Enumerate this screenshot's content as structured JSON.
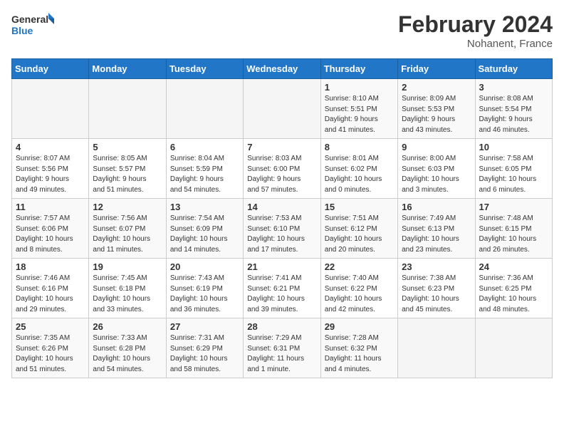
{
  "logo": {
    "line1": "General",
    "line2": "Blue"
  },
  "title": "February 2024",
  "location": "Nohanent, France",
  "days_of_week": [
    "Sunday",
    "Monday",
    "Tuesday",
    "Wednesday",
    "Thursday",
    "Friday",
    "Saturday"
  ],
  "weeks": [
    [
      {
        "day": "",
        "info": ""
      },
      {
        "day": "",
        "info": ""
      },
      {
        "day": "",
        "info": ""
      },
      {
        "day": "",
        "info": ""
      },
      {
        "day": "1",
        "info": "Sunrise: 8:10 AM\nSunset: 5:51 PM\nDaylight: 9 hours\nand 41 minutes."
      },
      {
        "day": "2",
        "info": "Sunrise: 8:09 AM\nSunset: 5:53 PM\nDaylight: 9 hours\nand 43 minutes."
      },
      {
        "day": "3",
        "info": "Sunrise: 8:08 AM\nSunset: 5:54 PM\nDaylight: 9 hours\nand 46 minutes."
      }
    ],
    [
      {
        "day": "4",
        "info": "Sunrise: 8:07 AM\nSunset: 5:56 PM\nDaylight: 9 hours\nand 49 minutes."
      },
      {
        "day": "5",
        "info": "Sunrise: 8:05 AM\nSunset: 5:57 PM\nDaylight: 9 hours\nand 51 minutes."
      },
      {
        "day": "6",
        "info": "Sunrise: 8:04 AM\nSunset: 5:59 PM\nDaylight: 9 hours\nand 54 minutes."
      },
      {
        "day": "7",
        "info": "Sunrise: 8:03 AM\nSunset: 6:00 PM\nDaylight: 9 hours\nand 57 minutes."
      },
      {
        "day": "8",
        "info": "Sunrise: 8:01 AM\nSunset: 6:02 PM\nDaylight: 10 hours\nand 0 minutes."
      },
      {
        "day": "9",
        "info": "Sunrise: 8:00 AM\nSunset: 6:03 PM\nDaylight: 10 hours\nand 3 minutes."
      },
      {
        "day": "10",
        "info": "Sunrise: 7:58 AM\nSunset: 6:05 PM\nDaylight: 10 hours\nand 6 minutes."
      }
    ],
    [
      {
        "day": "11",
        "info": "Sunrise: 7:57 AM\nSunset: 6:06 PM\nDaylight: 10 hours\nand 8 minutes."
      },
      {
        "day": "12",
        "info": "Sunrise: 7:56 AM\nSunset: 6:07 PM\nDaylight: 10 hours\nand 11 minutes."
      },
      {
        "day": "13",
        "info": "Sunrise: 7:54 AM\nSunset: 6:09 PM\nDaylight: 10 hours\nand 14 minutes."
      },
      {
        "day": "14",
        "info": "Sunrise: 7:53 AM\nSunset: 6:10 PM\nDaylight: 10 hours\nand 17 minutes."
      },
      {
        "day": "15",
        "info": "Sunrise: 7:51 AM\nSunset: 6:12 PM\nDaylight: 10 hours\nand 20 minutes."
      },
      {
        "day": "16",
        "info": "Sunrise: 7:49 AM\nSunset: 6:13 PM\nDaylight: 10 hours\nand 23 minutes."
      },
      {
        "day": "17",
        "info": "Sunrise: 7:48 AM\nSunset: 6:15 PM\nDaylight: 10 hours\nand 26 minutes."
      }
    ],
    [
      {
        "day": "18",
        "info": "Sunrise: 7:46 AM\nSunset: 6:16 PM\nDaylight: 10 hours\nand 29 minutes."
      },
      {
        "day": "19",
        "info": "Sunrise: 7:45 AM\nSunset: 6:18 PM\nDaylight: 10 hours\nand 33 minutes."
      },
      {
        "day": "20",
        "info": "Sunrise: 7:43 AM\nSunset: 6:19 PM\nDaylight: 10 hours\nand 36 minutes."
      },
      {
        "day": "21",
        "info": "Sunrise: 7:41 AM\nSunset: 6:21 PM\nDaylight: 10 hours\nand 39 minutes."
      },
      {
        "day": "22",
        "info": "Sunrise: 7:40 AM\nSunset: 6:22 PM\nDaylight: 10 hours\nand 42 minutes."
      },
      {
        "day": "23",
        "info": "Sunrise: 7:38 AM\nSunset: 6:23 PM\nDaylight: 10 hours\nand 45 minutes."
      },
      {
        "day": "24",
        "info": "Sunrise: 7:36 AM\nSunset: 6:25 PM\nDaylight: 10 hours\nand 48 minutes."
      }
    ],
    [
      {
        "day": "25",
        "info": "Sunrise: 7:35 AM\nSunset: 6:26 PM\nDaylight: 10 hours\nand 51 minutes."
      },
      {
        "day": "26",
        "info": "Sunrise: 7:33 AM\nSunset: 6:28 PM\nDaylight: 10 hours\nand 54 minutes."
      },
      {
        "day": "27",
        "info": "Sunrise: 7:31 AM\nSunset: 6:29 PM\nDaylight: 10 hours\nand 58 minutes."
      },
      {
        "day": "28",
        "info": "Sunrise: 7:29 AM\nSunset: 6:31 PM\nDaylight: 11 hours\nand 1 minute."
      },
      {
        "day": "29",
        "info": "Sunrise: 7:28 AM\nSunset: 6:32 PM\nDaylight: 11 hours\nand 4 minutes."
      },
      {
        "day": "",
        "info": ""
      },
      {
        "day": "",
        "info": ""
      }
    ]
  ]
}
